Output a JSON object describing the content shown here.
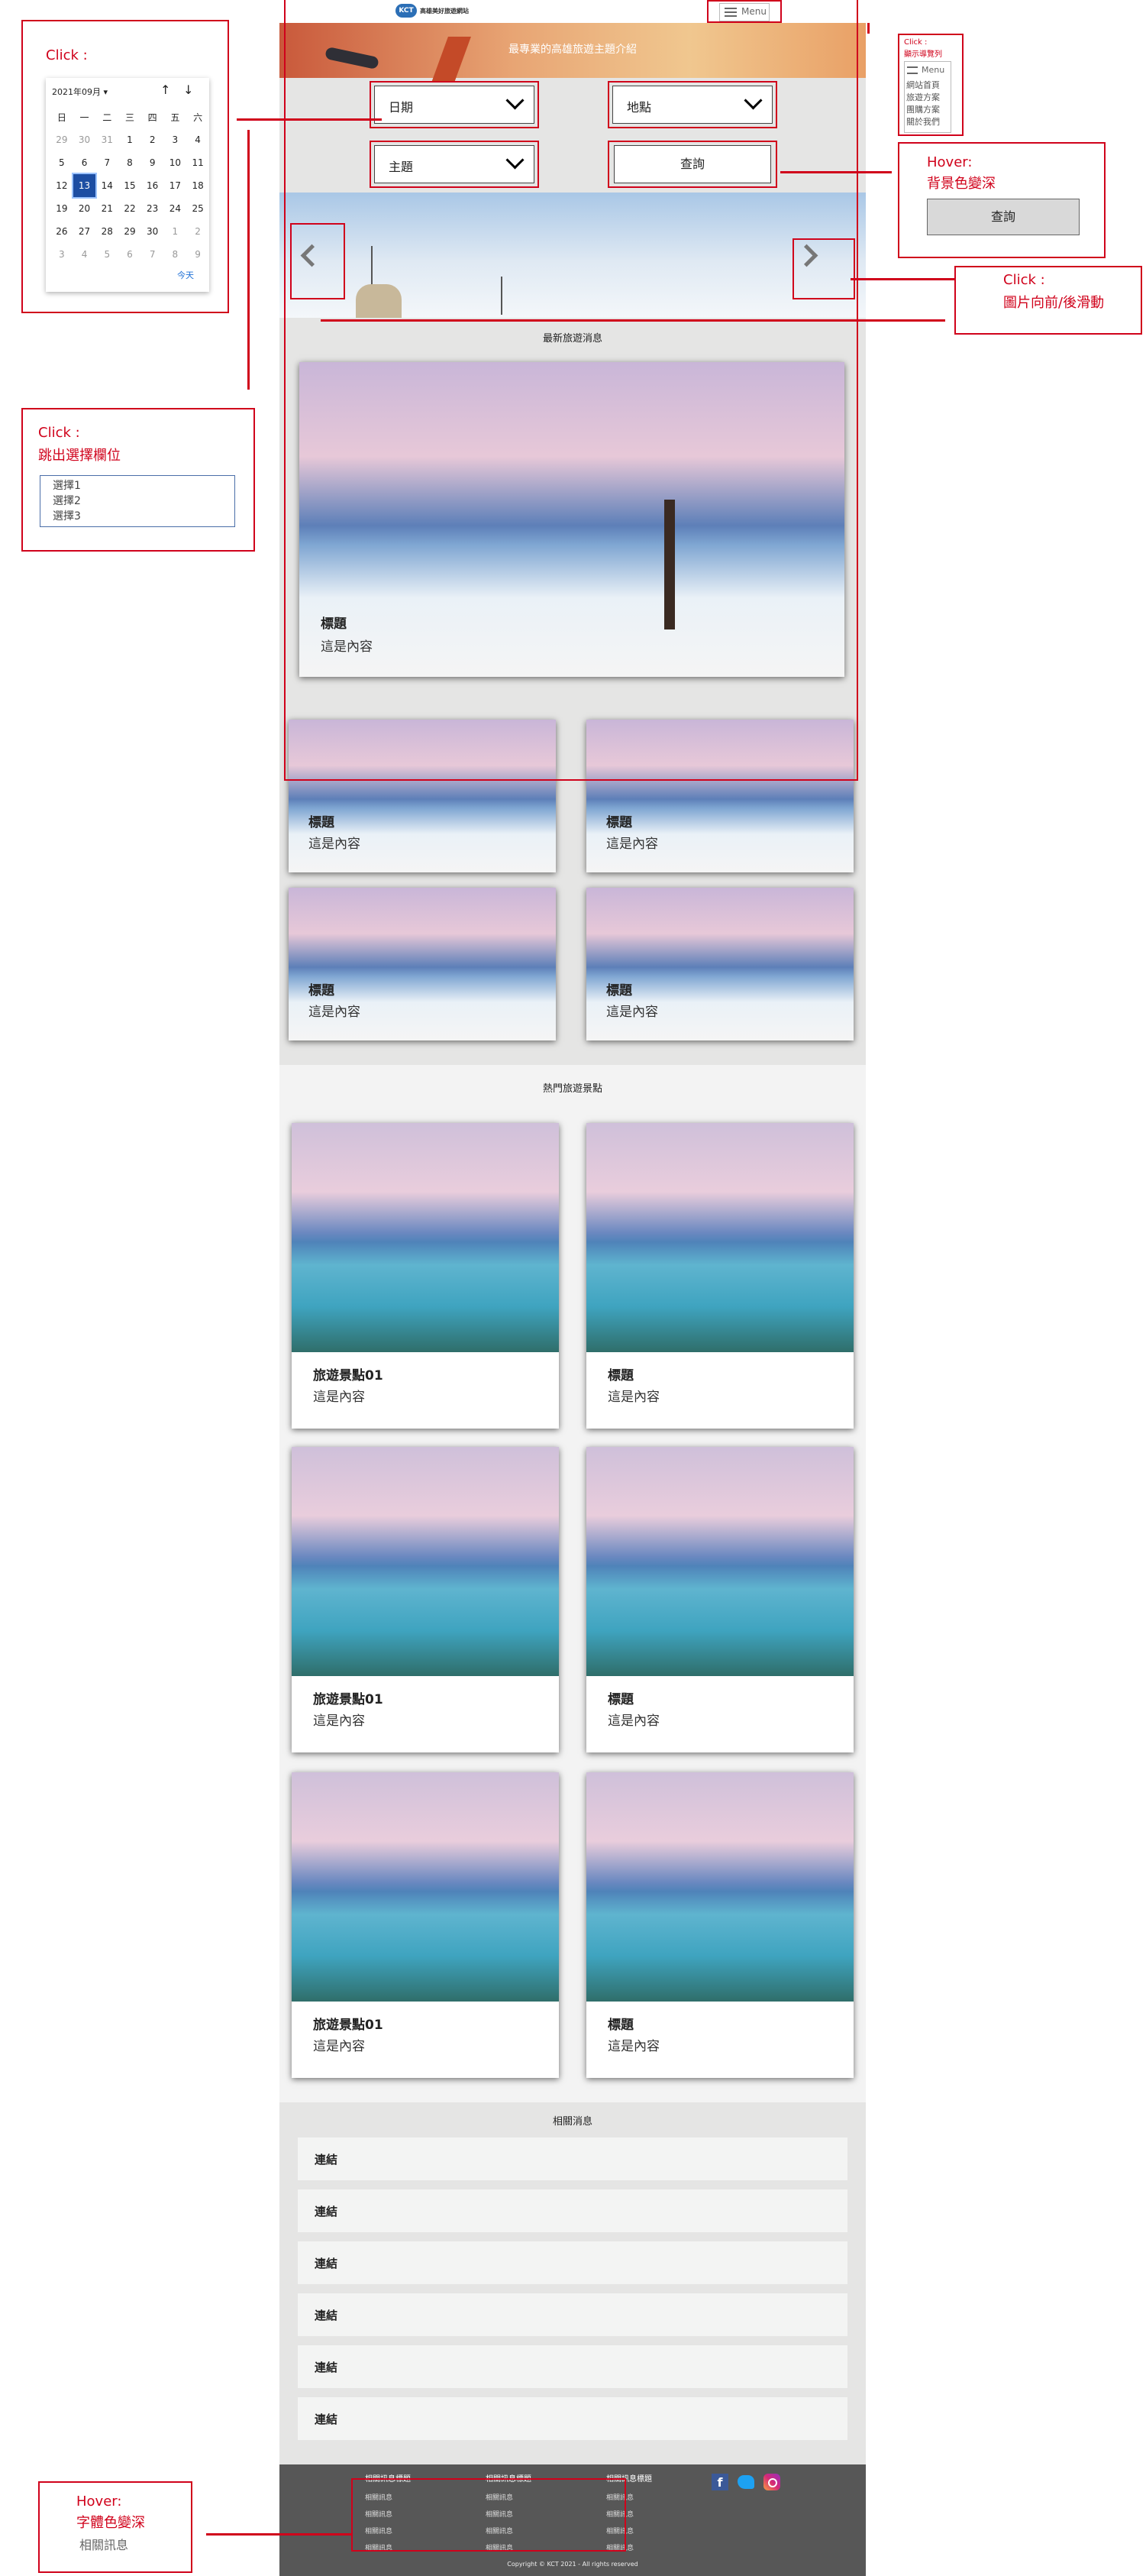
{
  "header": {
    "brand": "高雄美好旅遊網站",
    "logo": "KCT",
    "menu_label": "Menu"
  },
  "banner": {
    "text": "最專業的高雄旅遊主題介紹"
  },
  "search": {
    "date": "日期",
    "place": "地點",
    "theme": "主題",
    "query": "查詢"
  },
  "sections": {
    "news": "最新旅遊消息",
    "popular": "熱門旅遊景點",
    "links": "相關消息"
  },
  "news_main": {
    "title": "標題",
    "text": "這是內容"
  },
  "news_small": [
    {
      "title": "標題",
      "text": "這是內容"
    },
    {
      "title": "標題",
      "text": "這是內容"
    },
    {
      "title": "標題",
      "text": "這是內容"
    },
    {
      "title": "標題",
      "text": "這是內容"
    }
  ],
  "spots": [
    {
      "title": "旅遊景點01",
      "text": "這是內容"
    },
    {
      "title": "標題",
      "text": "這是內容"
    },
    {
      "title": "旅遊景點01",
      "text": "這是內容"
    },
    {
      "title": "標題",
      "text": "這是內容"
    },
    {
      "title": "旅遊景點01",
      "text": "這是內容"
    },
    {
      "title": "標題",
      "text": "這是內容"
    }
  ],
  "links": [
    "連結",
    "連結",
    "連結",
    "連結",
    "連結",
    "連結"
  ],
  "footer": {
    "columns": [
      {
        "head": "相關訊息標題",
        "items": [
          "相關訊息",
          "相關訊息",
          "相關訊息",
          "相關訊息"
        ]
      },
      {
        "head": "相關訊息標題",
        "items": [
          "相關訊息",
          "相關訊息",
          "相關訊息",
          "相關訊息"
        ]
      },
      {
        "head": "相關訊息標題",
        "items": [
          "相關訊息",
          "相關訊息",
          "相關訊息",
          "相關訊息"
        ]
      }
    ],
    "copyright": "Copyright © KCT 2021 - All rights reserved"
  },
  "annotations": {
    "cal_click": "Click :",
    "menu_click": "Click :",
    "menu_click_desc": "顯示導覽列",
    "menu_items": [
      "網站首頁",
      "旅遊方案",
      "團購方案",
      "關於我們"
    ],
    "hover_btn": "Hover:",
    "hover_btn_desc": "背景色變深",
    "hover_btn_label": "查詢",
    "slide_click": "Click :",
    "slide_click_desc": "圖片向前/後滑動",
    "select_click": "Click :",
    "select_click_desc": "跳出選擇欄位",
    "select_options": [
      "選擇1",
      "選擇2",
      "選擇3"
    ],
    "footer_hover": "Hover:",
    "footer_hover_desc": "字體色變深",
    "footer_hover_sample": "相關訊息"
  },
  "calendar": {
    "month_label": "2021年09月 ▾",
    "weekdays": [
      "日",
      "一",
      "二",
      "三",
      "四",
      "五",
      "六"
    ],
    "rows": [
      [
        "29",
        "30",
        "31",
        "1",
        "2",
        "3",
        "4"
      ],
      [
        "5",
        "6",
        "7",
        "8",
        "9",
        "10",
        "11"
      ],
      [
        "12",
        "13",
        "14",
        "15",
        "16",
        "17",
        "18"
      ],
      [
        "19",
        "20",
        "21",
        "22",
        "23",
        "24",
        "25"
      ],
      [
        "26",
        "27",
        "28",
        "29",
        "30",
        "1",
        "2"
      ],
      [
        "3",
        "4",
        "5",
        "6",
        "7",
        "8",
        "9"
      ]
    ],
    "selected": "13",
    "today": "今天"
  },
  "colors": {
    "accent": "#d0021b",
    "footer_bg": "#575757",
    "page_bg": "#e5e5e4"
  }
}
